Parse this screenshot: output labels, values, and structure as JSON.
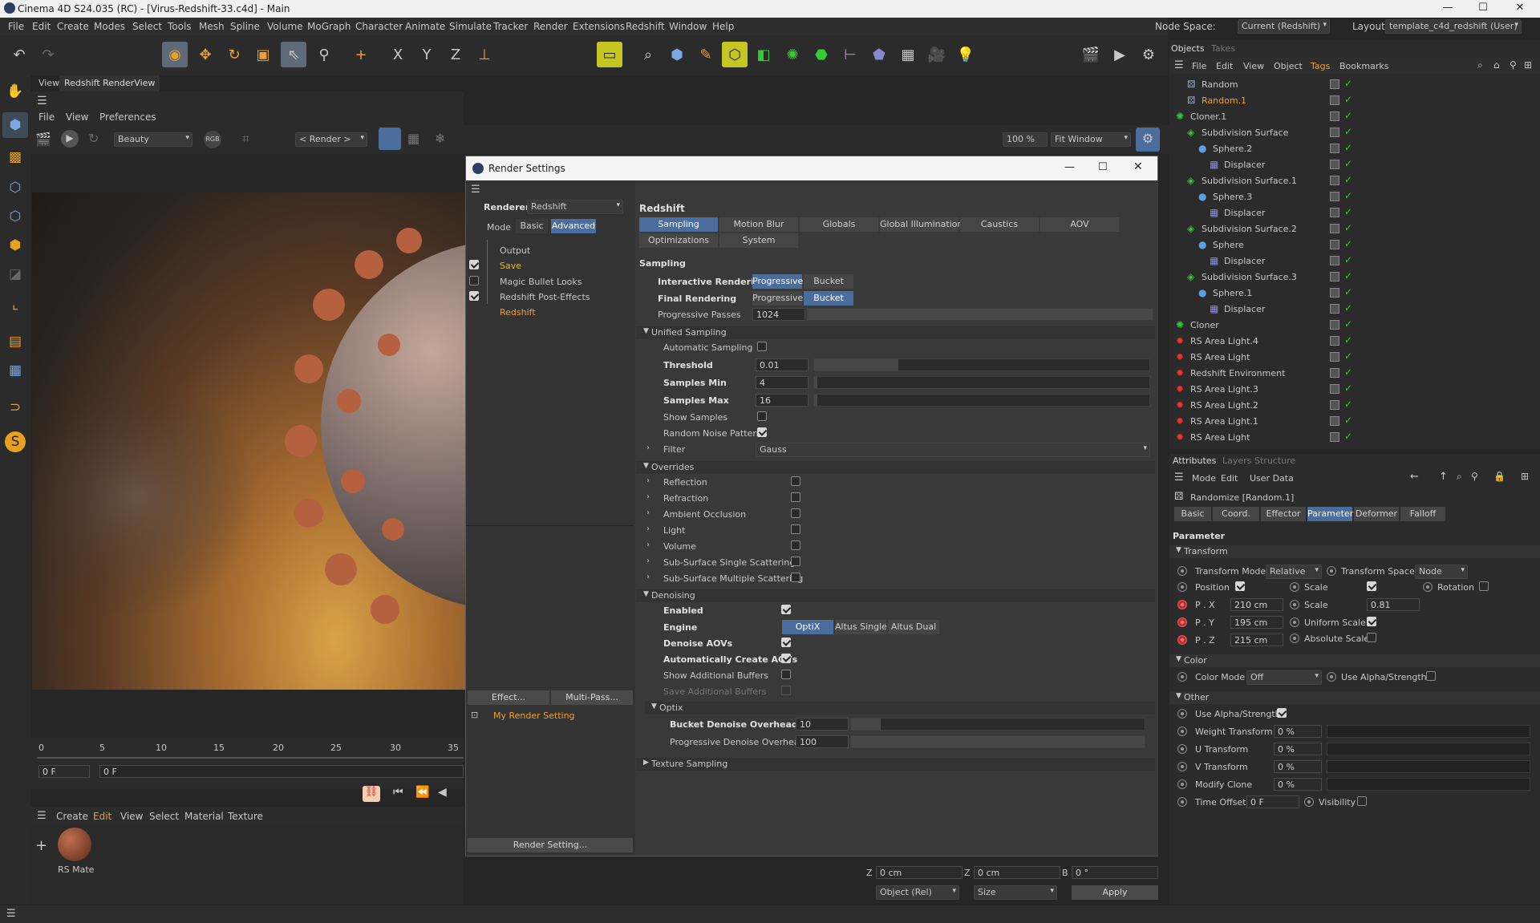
{
  "window": {
    "title": "Cinema 4D S24.035 (RC) - [Virus-Redshift-33.c4d] - Main",
    "min": "—",
    "max": "☐",
    "close": "✕"
  },
  "menu": [
    "File",
    "Edit",
    "Create",
    "Modes",
    "Select",
    "Tools",
    "Mesh",
    "Spline",
    "Volume",
    "MoGraph",
    "Character",
    "Animate",
    "Simulate",
    "Tracker",
    "Render",
    "Extensions",
    "Redshift",
    "Window",
    "Help"
  ],
  "nodespace": {
    "label": "Node Space:",
    "value": "Current (Redshift)"
  },
  "layout": {
    "label": "Layout:",
    "value": "template_c4d_redshift (User)"
  },
  "viewport_tabs": [
    "View",
    "Redshift RenderView"
  ],
  "rv_menu": [
    "File",
    "View",
    "Preferences"
  ],
  "rv": {
    "aov": "Beauty",
    "camera": "< Render >",
    "zoom": "100 %",
    "fit": "Fit Window"
  },
  "timeline": {
    "ticks": [
      "0",
      "5",
      "10",
      "15",
      "20",
      "25",
      "30",
      "35"
    ],
    "frame": "0 F",
    "frame2": "0 F"
  },
  "matmenu": [
    "Create",
    "Edit",
    "View",
    "Select",
    "Material",
    "Texture"
  ],
  "material": {
    "name": "RS Mate"
  },
  "coords": {
    "z1": "0 cm",
    "z2": "0 cm",
    "b": "0 °",
    "sel1": "Object (Rel)",
    "sel2": "Size",
    "apply": "Apply",
    "labels": {
      "z": "Z",
      "b": "B"
    }
  },
  "dialog": {
    "title": "Render Settings",
    "renderer_label": "Renderer",
    "renderer": "Redshift",
    "mode_label": "Mode",
    "modes": [
      "Basic",
      "Advanced"
    ],
    "tree": [
      "Output",
      "Save",
      "Magic Bullet Looks",
      "Redshift Post-Effects",
      "Redshift"
    ],
    "effect_btn": "Effect...",
    "multipass_btn": "Multi-Pass...",
    "setting": "My Render Setting",
    "render_setting_btn": "Render Setting...",
    "heading": "Redshift",
    "tabs": [
      "Sampling",
      "Motion Blur",
      "Globals",
      "Global Illumination",
      "Caustics",
      "AOV",
      "Optimizations",
      "System"
    ],
    "sampling": "Sampling",
    "interactive_label": "Interactive Rendering",
    "final_label": "Final Rendering",
    "prog": "Progressive",
    "bucket": "Bucket",
    "passes_label": "Progressive Passes",
    "passes": "1024",
    "unified": "Unified Sampling",
    "auto_sampling": "Automatic Sampling",
    "threshold_label": "Threshold",
    "threshold": "0.01",
    "smin_label": "Samples Min",
    "smin": "4",
    "smax_label": "Samples Max",
    "smax": "16",
    "show_samples": "Show Samples",
    "random_noise": "Random Noise Pattern",
    "filter_label": "Filter",
    "filter": "Gauss",
    "overrides": "Overrides",
    "override_items": [
      "Reflection",
      "Refraction",
      "Ambient Occlusion",
      "Light",
      "Volume",
      "Sub-Surface Single Scattering",
      "Sub-Surface Multiple Scattering"
    ],
    "denoising": "Denoising",
    "enabled": "Enabled",
    "engine_label": "Engine",
    "engines": [
      "OptiX",
      "Altus Single",
      "Altus Dual"
    ],
    "denoise_aovs": "Denoise AOVs",
    "auto_aovs": "Automatically Create AOVs",
    "show_buffers": "Show Additional Buffers",
    "save_buffers": "Save Additional Buffers",
    "optix": "Optix",
    "bucket_overhead_label": "Bucket Denoise Overhead",
    "bucket_overhead": "10",
    "prog_overhead_label": "Progressive Denoise Overhead",
    "prog_overhead": "100",
    "texture_sampling": "Texture Sampling",
    "values": {
      "threshold_frac": 0.25,
      "smin_frac": 0.01,
      "smax_frac": 0.01,
      "passes_frac": 1.0,
      "bucket_frac": 0.1,
      "prog_frac": 1.0
    }
  },
  "objects_tabs": [
    "Objects",
    "Takes"
  ],
  "objects_menu": [
    "File",
    "Edit",
    "View",
    "Object",
    "Tags",
    "Bookmarks"
  ],
  "objects": [
    {
      "name": "Random",
      "indent": 1,
      "icon": "random-icon",
      "color": "#c8c8c8"
    },
    {
      "name": "Random.1",
      "indent": 1,
      "icon": "random-icon",
      "color": "#f0a030"
    },
    {
      "name": "Cloner.1",
      "indent": 0,
      "icon": "cloner-icon",
      "color": "#c8c8c8"
    },
    {
      "name": "Subdivision Surface",
      "indent": 1,
      "icon": "subdiv-icon",
      "color": "#c8c8c8"
    },
    {
      "name": "Sphere.2",
      "indent": 2,
      "icon": "sphere-icon",
      "color": "#c8c8c8"
    },
    {
      "name": "Displacer",
      "indent": 3,
      "icon": "displacer-icon",
      "color": "#c8c8c8"
    },
    {
      "name": "Subdivision Surface.1",
      "indent": 1,
      "icon": "subdiv-icon",
      "color": "#c8c8c8"
    },
    {
      "name": "Sphere.3",
      "indent": 2,
      "icon": "sphere-icon",
      "color": "#c8c8c8"
    },
    {
      "name": "Displacer",
      "indent": 3,
      "icon": "displacer-icon",
      "color": "#c8c8c8"
    },
    {
      "name": "Subdivision Surface.2",
      "indent": 1,
      "icon": "subdiv-icon",
      "color": "#c8c8c8"
    },
    {
      "name": "Sphere",
      "indent": 2,
      "icon": "sphere-icon",
      "color": "#c8c8c8"
    },
    {
      "name": "Displacer",
      "indent": 3,
      "icon": "displacer-icon",
      "color": "#c8c8c8"
    },
    {
      "name": "Subdivision Surface.3",
      "indent": 1,
      "icon": "subdiv-icon",
      "color": "#c8c8c8"
    },
    {
      "name": "Sphere.1",
      "indent": 2,
      "icon": "sphere-icon",
      "color": "#c8c8c8"
    },
    {
      "name": "Displacer",
      "indent": 3,
      "icon": "displacer-icon",
      "color": "#c8c8c8"
    },
    {
      "name": "Cloner",
      "indent": 0,
      "icon": "cloner-icon",
      "color": "#c8c8c8"
    },
    {
      "name": "RS Area Light.4",
      "indent": 0,
      "icon": "light-icon",
      "color": "#c8c8c8"
    },
    {
      "name": "RS Area Light",
      "indent": 0,
      "icon": "light-icon",
      "color": "#c8c8c8"
    },
    {
      "name": "Redshift Environment",
      "indent": 0,
      "icon": "light-icon",
      "color": "#c8c8c8"
    },
    {
      "name": "RS Area Light.3",
      "indent": 0,
      "icon": "light-icon",
      "color": "#c8c8c8"
    },
    {
      "name": "RS Area Light.2",
      "indent": 0,
      "icon": "light-icon",
      "color": "#c8c8c8"
    },
    {
      "name": "RS Area Light.1",
      "indent": 0,
      "icon": "light-icon",
      "color": "#c8c8c8"
    },
    {
      "name": "RS Area Light",
      "indent": 0,
      "icon": "light-icon",
      "color": "#c8c8c8"
    }
  ],
  "attr_tabs": [
    "Attributes",
    "Layers",
    "Structure"
  ],
  "attr_menu": [
    "Mode",
    "Edit",
    "User Data"
  ],
  "attr_title": "Randomize [Random.1]",
  "attr_subtabs": [
    "Basic",
    "Coord.",
    "Effector",
    "Parameter",
    "Deformer",
    "Falloff"
  ],
  "param": "Parameter",
  "transform": "Transform",
  "tmode_label": "Transform Mode",
  "tmode": "Relative",
  "tspace_label": "Transform Space",
  "tspace": "Node",
  "position": "Position",
  "scale": "Scale",
  "rotation": "Rotation",
  "px_label": "P . X",
  "px": "210 cm",
  "py_label": "P . Y",
  "py": "195 cm",
  "pz_label": "P . Z",
  "pz": "215 cm",
  "scale2": "Scale",
  "scale_val": "0.81",
  "uniform": "Uniform Scale",
  "absolute": "Absolute Scale",
  "color_sec": "Color",
  "color_mode_label": "Color Mode",
  "color_mode": "Off",
  "use_alpha": "Use Alpha/Strength",
  "other": "Other",
  "use_alpha2": "Use Alpha/Strength",
  "other_rows": [
    {
      "label": "Weight Transform",
      "val": "0 %"
    },
    {
      "label": "U Transform",
      "val": "0 %"
    },
    {
      "label": "V Transform",
      "val": "0 %"
    },
    {
      "label": "Modify Clone",
      "val": "0 %"
    }
  ],
  "time_offset_label": "Time Offset",
  "time_offset": "0 F",
  "visibility": "Visibility",
  "colors": {
    "accent": "#4a6d9e",
    "orange": "#f0a030",
    "highlight": "#c6c622"
  }
}
